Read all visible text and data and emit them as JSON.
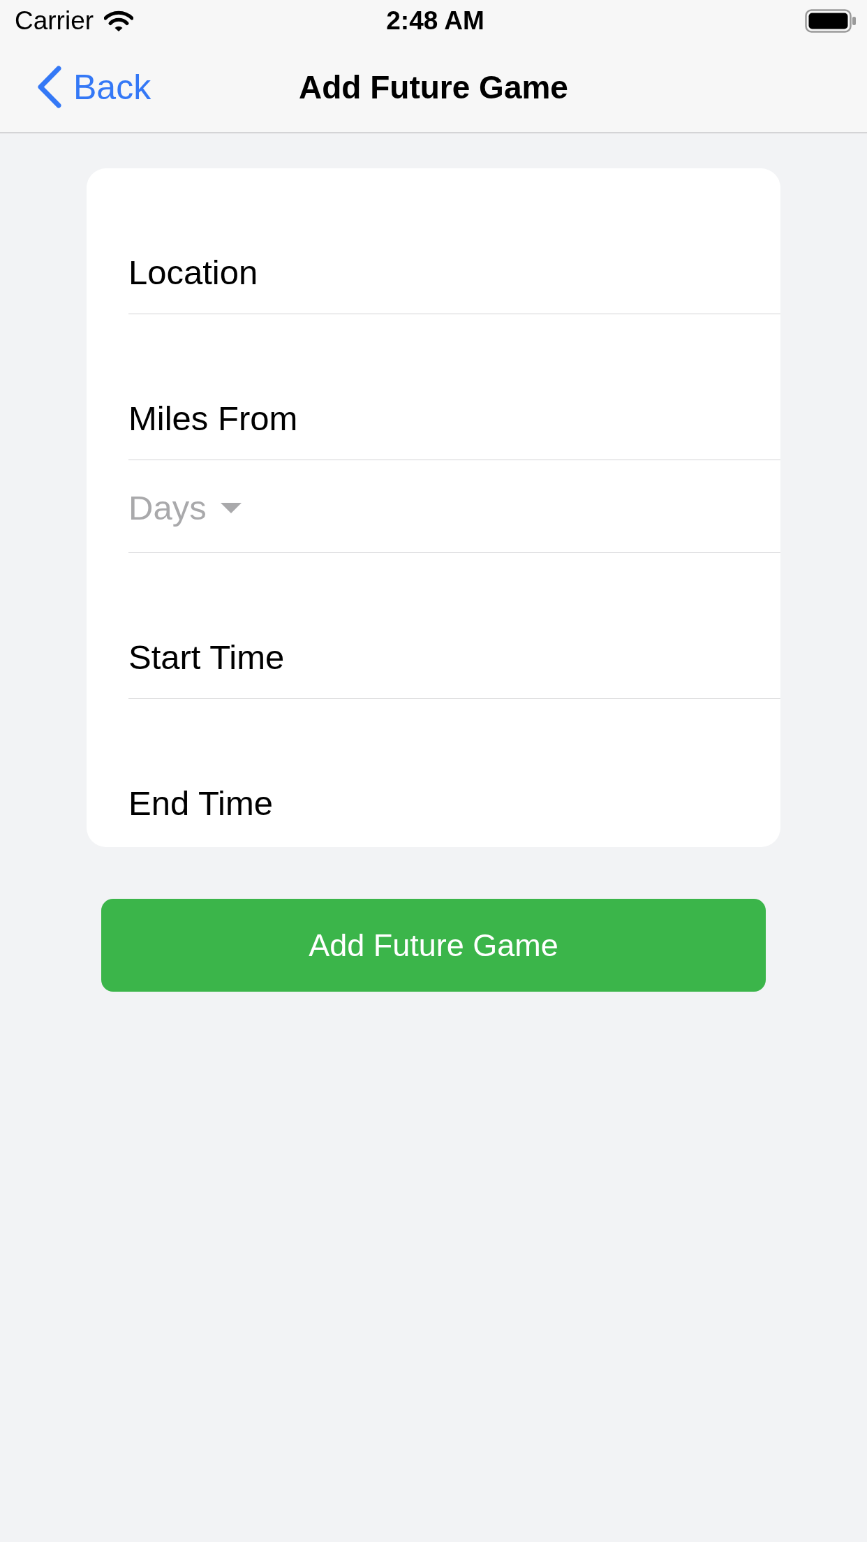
{
  "status_bar": {
    "carrier": "Carrier",
    "time": "2:48 AM"
  },
  "nav_bar": {
    "back": "Back",
    "title": "Add Future Game"
  },
  "form": {
    "fields": [
      {
        "kind": "text",
        "label": "Location"
      },
      {
        "kind": "text",
        "label": "Miles From"
      },
      {
        "kind": "dropdown",
        "placeholder": "Days"
      },
      {
        "kind": "text",
        "label": "Start Time"
      },
      {
        "kind": "text",
        "label": "End Time"
      }
    ]
  },
  "submit_button": {
    "label": "Add Future Game"
  }
}
